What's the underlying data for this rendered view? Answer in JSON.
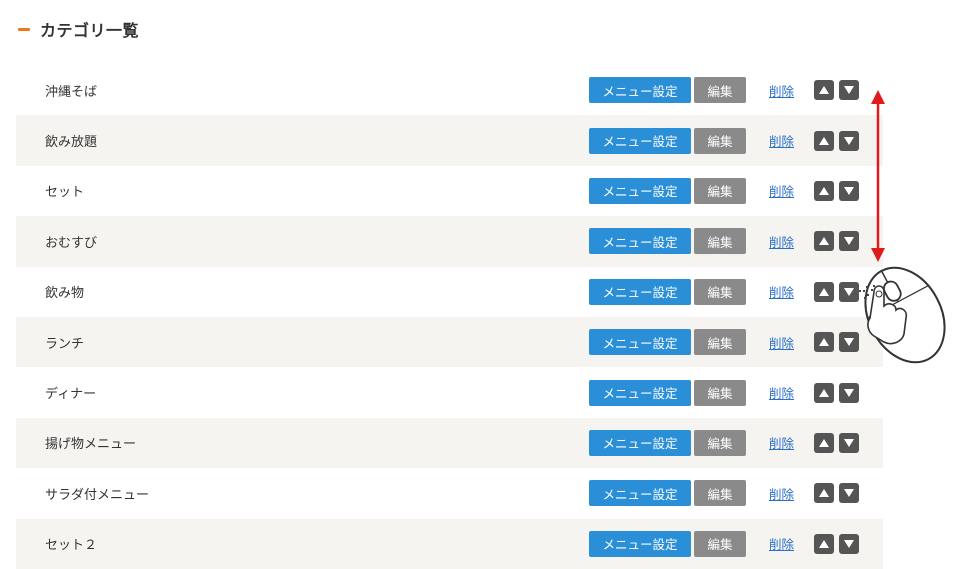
{
  "section": {
    "title": "カテゴリ一覧"
  },
  "categories": [
    {
      "name": "沖縄そば",
      "menu_btn": "メニュー設定",
      "edit_btn": "編集",
      "delete_link": "削除"
    },
    {
      "name": "飲み放題",
      "menu_btn": "メニュー設定",
      "edit_btn": "編集",
      "delete_link": "削除"
    },
    {
      "name": "セット",
      "menu_btn": "メニュー設定",
      "edit_btn": "編集",
      "delete_link": "削除"
    },
    {
      "name": "おむすび",
      "menu_btn": "メニュー設定",
      "edit_btn": "編集",
      "delete_link": "削除"
    },
    {
      "name": "飲み物",
      "menu_btn": "メニュー設定",
      "edit_btn": "編集",
      "delete_link": "削除"
    },
    {
      "name": "ランチ",
      "menu_btn": "メニュー設定",
      "edit_btn": "編集",
      "delete_link": "削除"
    },
    {
      "name": "ディナー",
      "menu_btn": "メニュー設定",
      "edit_btn": "編集",
      "delete_link": "削除"
    },
    {
      "name": "揚げ物メニュー",
      "menu_btn": "メニュー設定",
      "edit_btn": "編集",
      "delete_link": "削除"
    },
    {
      "name": "サラダ付メニュー",
      "menu_btn": "メニュー設定",
      "edit_btn": "編集",
      "delete_link": "削除"
    },
    {
      "name": "セット２",
      "menu_btn": "メニュー設定",
      "edit_btn": "編集",
      "delete_link": "削除"
    }
  ],
  "icons": {
    "section_marker": "dash-icon",
    "move_up": "arrow-up-icon",
    "move_down": "arrow-down-icon",
    "annotation_arrow": "double-arrow-icon",
    "mouse": "mouse-click-icon"
  },
  "colors": {
    "accent": "#f07a1b",
    "menu_button": "#2b8fd8",
    "edit_button": "#8a8a8a",
    "link": "#2a6fc9",
    "row_alt": "#f5f4f1",
    "annotation": "#e01b1b"
  }
}
